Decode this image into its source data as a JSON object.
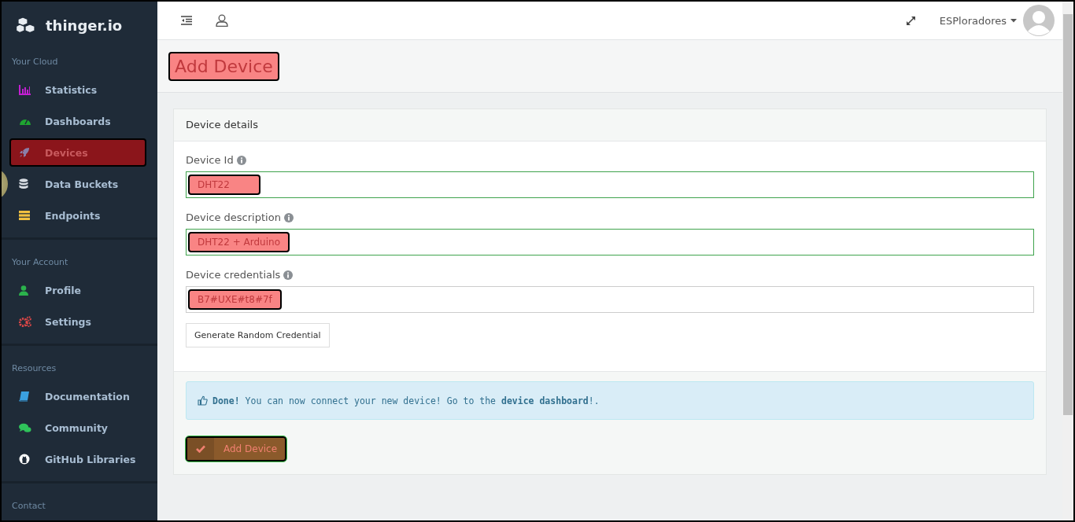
{
  "brand": {
    "name": "thinger.io"
  },
  "sidebar": {
    "sections": [
      {
        "title": "Your Cloud",
        "items": [
          {
            "label": "Statistics",
            "selected": false
          },
          {
            "label": "Dashboards",
            "selected": false
          },
          {
            "label": "Devices",
            "selected": true
          },
          {
            "label": "Data Buckets",
            "selected": false
          },
          {
            "label": "Endpoints",
            "selected": false
          }
        ]
      },
      {
        "title": "Your Account",
        "items": [
          {
            "label": "Profile",
            "selected": false
          },
          {
            "label": "Settings",
            "selected": false
          }
        ]
      },
      {
        "title": "Resources",
        "items": [
          {
            "label": "Documentation",
            "selected": false
          },
          {
            "label": "Community",
            "selected": false
          },
          {
            "label": "GitHub Libraries",
            "selected": false
          }
        ]
      },
      {
        "title": "Contact"
      }
    ]
  },
  "topbar": {
    "user": "ESPloradores"
  },
  "page": {
    "title": "Add Device",
    "highlighted": true
  },
  "panel": {
    "heading": "Device details",
    "fields": [
      {
        "label": "Device Id",
        "value": "DHT22",
        "valid": true,
        "highlighted": true
      },
      {
        "label": "Device description",
        "value": "DHT22 + Arduino",
        "valid": true,
        "highlighted": true
      },
      {
        "label": "Device credentials",
        "value": "B7#UXE#t8#7f",
        "valid": false,
        "highlighted": true
      }
    ],
    "generate_button": "Generate Random Credential",
    "alert": "**Done!** You can now connect your new device! Go to the **device dashboard**!.",
    "submit_button": "Add Device"
  }
}
